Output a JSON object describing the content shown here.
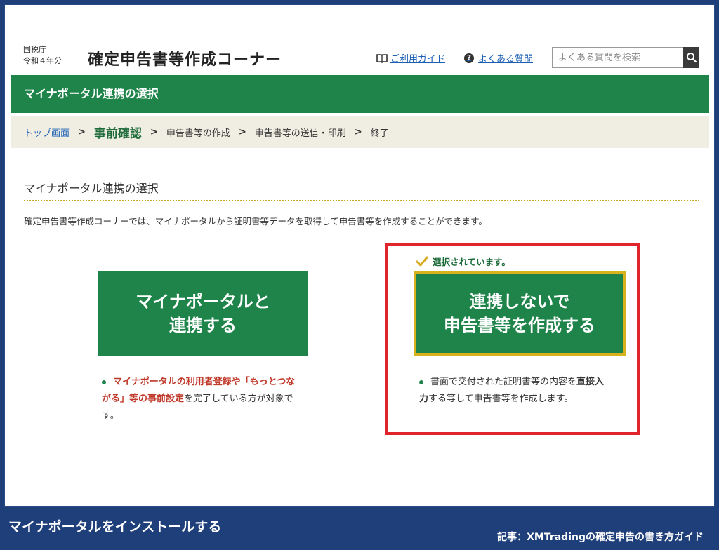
{
  "header": {
    "agency_line1": "国税庁",
    "agency_line2": "令和４年分",
    "title": "確定申告書等作成コーナー",
    "guide_link": "ご利用ガイド",
    "faq_link": "よくある質問",
    "search_placeholder": "よくある質問を検索"
  },
  "green_bar": {
    "title": "マイナポータル連携の選択"
  },
  "breadcrumb": {
    "items": [
      "トップ画面",
      "事前確認",
      "申告書等の作成",
      "申告書等の送信・印刷",
      "終了"
    ],
    "separator": ">"
  },
  "section": {
    "title": "マイナポータル連携の選択",
    "description": "確定申告書等作成コーナーでは、マイナポータルから証明書等データを取得して申告書等を作成することができます。"
  },
  "option1": {
    "button_line1": "マイナポータルと",
    "button_line2": "連携する",
    "note_red": "マイナポータルの利用者登録や「もっとつながる」等の事前設定",
    "note_rest": "を完了している方が対象です。"
  },
  "option2": {
    "selected_label": "選択されています。",
    "button_line1": "連携しないで",
    "button_line2": "申告書等を作成する",
    "note_pre": "書面で交付された証明書等の内容を",
    "note_bold": "直接入力",
    "note_post": "する等して申告書等を作成します。"
  },
  "captions": {
    "left": "マイナポータルをインストールする",
    "right": "記事：XMTradingの確定申告の書き方ガイド"
  },
  "colors": {
    "green": "#1e8449",
    "navy": "#1f3f7a",
    "highlight_red": "#e0242c",
    "gold": "#d7b21c",
    "link": "#1a5fb4"
  },
  "icons": {
    "guide": "book-icon",
    "faq": "question-icon",
    "search": "search-icon",
    "selected": "check-icon"
  }
}
